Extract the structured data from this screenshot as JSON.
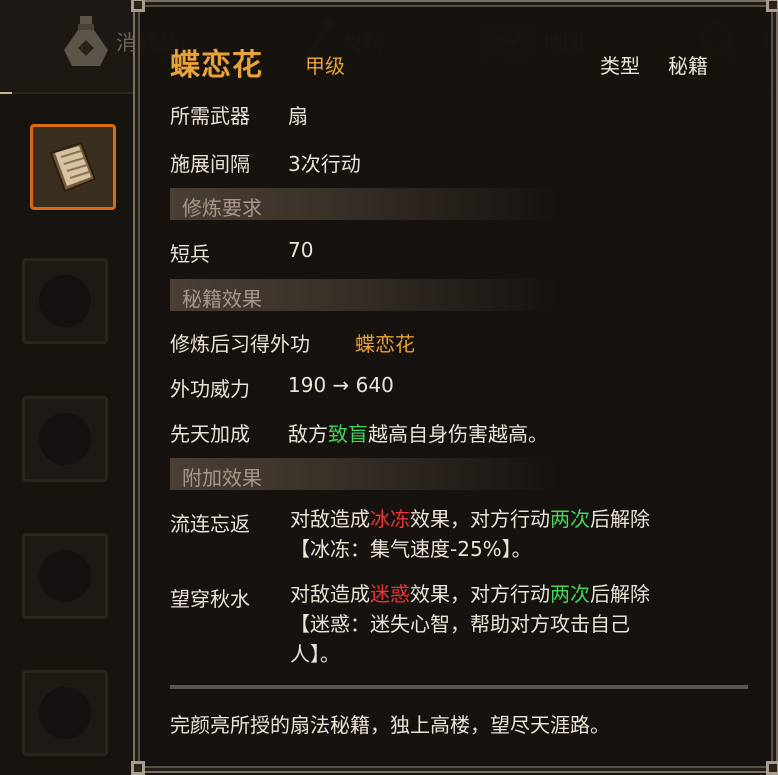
{
  "tabs": [
    {
      "label": "消耗品",
      "icon": "potion-icon"
    },
    {
      "label": "材料",
      "icon": "herb-icon"
    },
    {
      "label": "地图",
      "icon": "map-icon"
    },
    {
      "label": "",
      "icon": "magnifier-icon"
    },
    {
      "label": "事",
      "icon": ""
    }
  ],
  "tooltip": {
    "name": "蝶恋花",
    "grade": "甲级",
    "type_key": "类型",
    "type_value": "秘籍",
    "weapon_key": "所需武器",
    "weapon_value": "扇",
    "interval_key": "施展间隔",
    "interval_value": "3次行动",
    "section_req": "修炼要求",
    "req_key": "短兵",
    "req_value": "70",
    "section_effect": "秘籍效果",
    "learn_key": "修炼后习得外功",
    "learn_value": "蝶恋花",
    "power_key": "外功威力",
    "power_value": "190 → 640",
    "innate_key": "先天加成",
    "innate_pre": "敌方",
    "innate_hl": "致盲",
    "innate_post": "越高自身伤害越高。",
    "section_extra": "附加效果",
    "extra1_key": "流连忘返",
    "extra1_a": "对敌造成",
    "extra1_b": "冰冻",
    "extra1_c": "效果，对方行动",
    "extra1_d": "两次",
    "extra1_e": "后解除",
    "extra1_line2": "【冰冻：集气速度-25%】。",
    "extra2_key": "望穿秋水",
    "extra2_a": "对敌造成",
    "extra2_b": "迷惑",
    "extra2_c": "效果，对方行动",
    "extra2_d": "两次",
    "extra2_e": "后解除",
    "extra2_line2": "【迷惑：迷失心智，帮助对方攻击自己",
    "extra2_line3": "人】。",
    "flavor": "完颜亮所授的扇法秘籍，独上高楼，望尽天涯路。"
  },
  "colors": {
    "accent": "#e8a23a",
    "green": "#46d35a",
    "red": "#ee3434",
    "selected_slot": "#d86b16"
  }
}
